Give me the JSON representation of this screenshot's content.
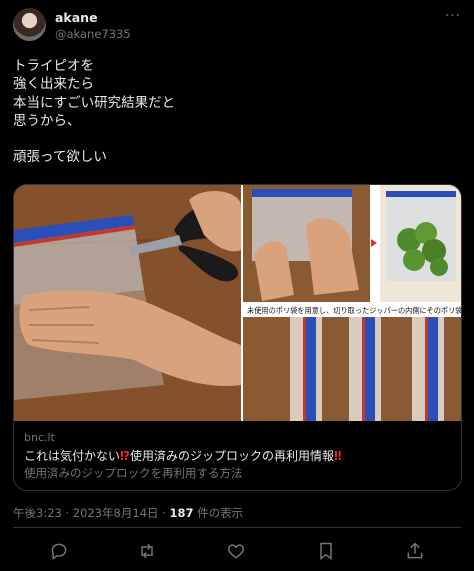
{
  "user": {
    "display_name": "akane",
    "handle": "@akane7335"
  },
  "tweet": {
    "lines": [
      "トライピオを",
      "強く出来たら",
      "本当にすごい研究結果だと",
      "思うから、",
      "",
      "頑張って欲しい"
    ]
  },
  "card": {
    "image_caption": "未使用のポリ袋を用意し、切り取ったジッパーの内側にそのポリ袋を",
    "domain": "bnc.lt",
    "title_prefix": "これは気付かない",
    "title_emoji1": "⁉",
    "title_main": "使用済みのジップロックの再利用情報",
    "title_emoji2": "‼",
    "description": "使用済みのジップロックを再利用する方法"
  },
  "meta": {
    "timestamp": "午後3:23 · 2023年8月14日 · ",
    "views_count": "187",
    "views_label": " 件の表示"
  },
  "actions": {
    "reply": "reply-icon",
    "retweet": "retweet-icon",
    "like": "heart-icon",
    "bookmark": "bookmark-icon",
    "share": "share-icon"
  },
  "colors": {
    "background": "#000000",
    "text": "#e7e9ea",
    "secondary": "#71767b",
    "border": "#2f3336",
    "alert": "#f4212e"
  }
}
